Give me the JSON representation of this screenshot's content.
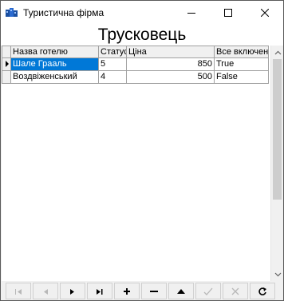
{
  "window": {
    "title": "Туристична фірма",
    "heading": "Трусковець"
  },
  "grid": {
    "columns": [
      "Назва готелю",
      "Статус",
      "Ціна",
      "Все включено"
    ],
    "rows": [
      {
        "name": "Шале Грааль",
        "status": "5",
        "price": "850",
        "all_inclusive": "True",
        "selected": true
      },
      {
        "name": "Воздвіженський",
        "status": "4",
        "price": "500",
        "all_inclusive": "False",
        "selected": false
      }
    ]
  },
  "navigator": {
    "buttons": [
      {
        "name": "first",
        "icon": "first-icon",
        "enabled": false
      },
      {
        "name": "prior",
        "icon": "prior-icon",
        "enabled": false
      },
      {
        "name": "next",
        "icon": "next-icon",
        "enabled": true
      },
      {
        "name": "last",
        "icon": "last-icon",
        "enabled": true
      },
      {
        "name": "insert",
        "icon": "plus-icon",
        "enabled": true
      },
      {
        "name": "delete",
        "icon": "minus-icon",
        "enabled": true
      },
      {
        "name": "edit",
        "icon": "edit-icon",
        "enabled": true
      },
      {
        "name": "post",
        "icon": "check-icon",
        "enabled": false
      },
      {
        "name": "cancel",
        "icon": "cancel-icon",
        "enabled": false
      },
      {
        "name": "refresh",
        "icon": "refresh-icon",
        "enabled": true
      }
    ]
  },
  "colors": {
    "selection": "#0078d7",
    "face": "#f0f0f0",
    "gridline": "#a0a0a0"
  }
}
